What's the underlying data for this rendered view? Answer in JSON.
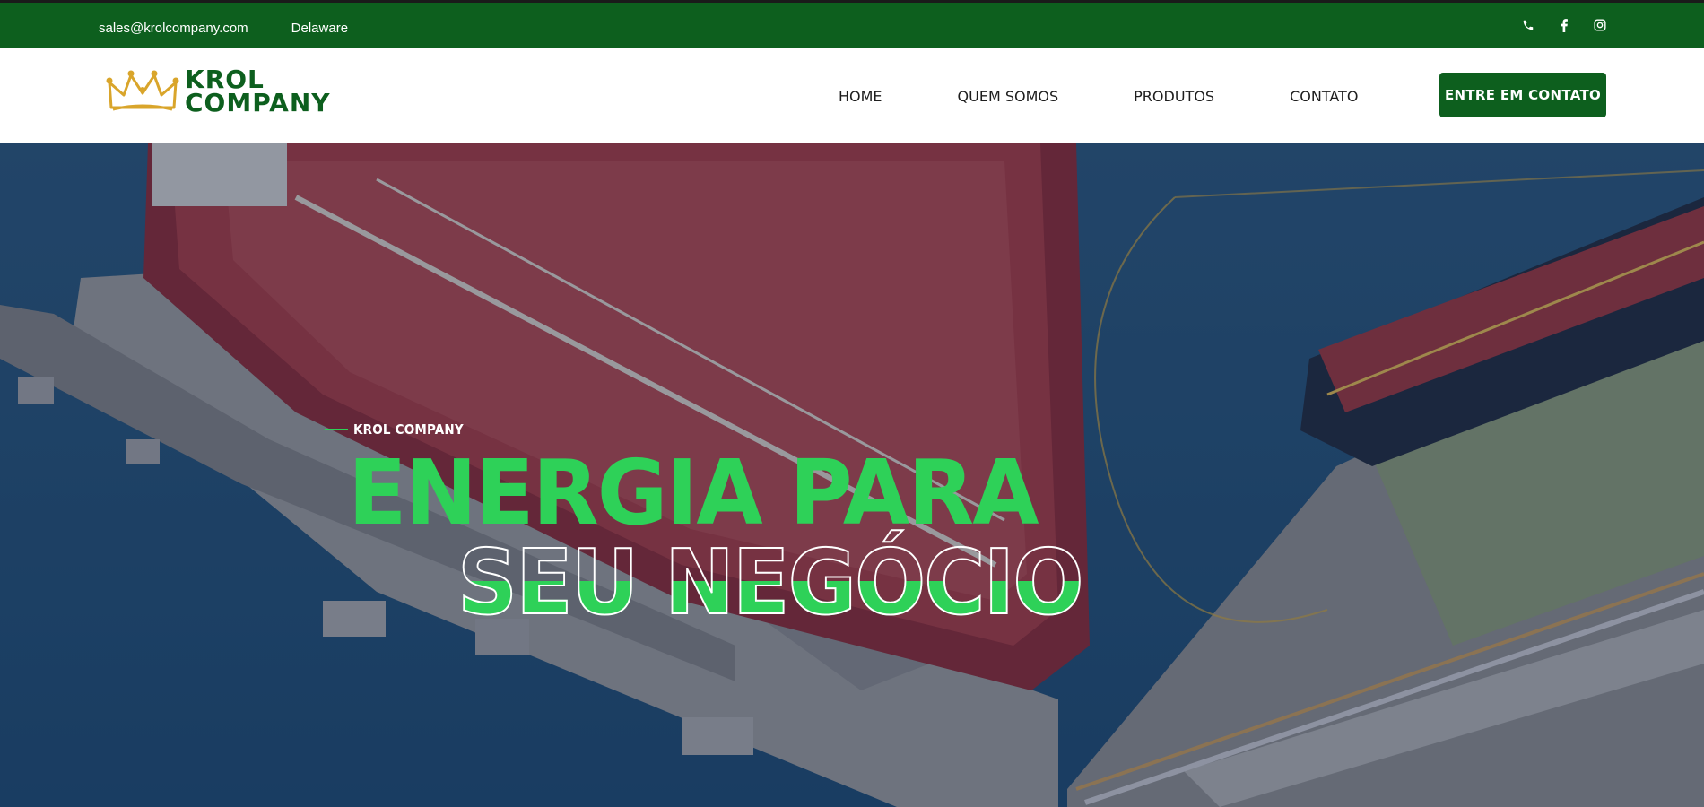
{
  "topbar": {
    "email": "sales@krolcompany.com",
    "location": "Delaware",
    "social_icons": [
      "phone-icon",
      "facebook-icon",
      "instagram-icon"
    ]
  },
  "nav": {
    "logo_line1": "KROL",
    "logo_line2": "COMPANY",
    "links": [
      "HOME",
      "QUEM SOMOS",
      "PRODUTOS",
      "CONTATO"
    ],
    "cta_label": "ENTRE EM CONTATO"
  },
  "hero": {
    "eyebrow": "KROL COMPANY",
    "headline_line1": "ENERGIA PARA",
    "headline_line2": "SEU NEGÓCIO"
  },
  "colors": {
    "brand_green": "#0d5f1e",
    "accent_green": "#2ed158",
    "logo_gold": "#d9a52b"
  }
}
